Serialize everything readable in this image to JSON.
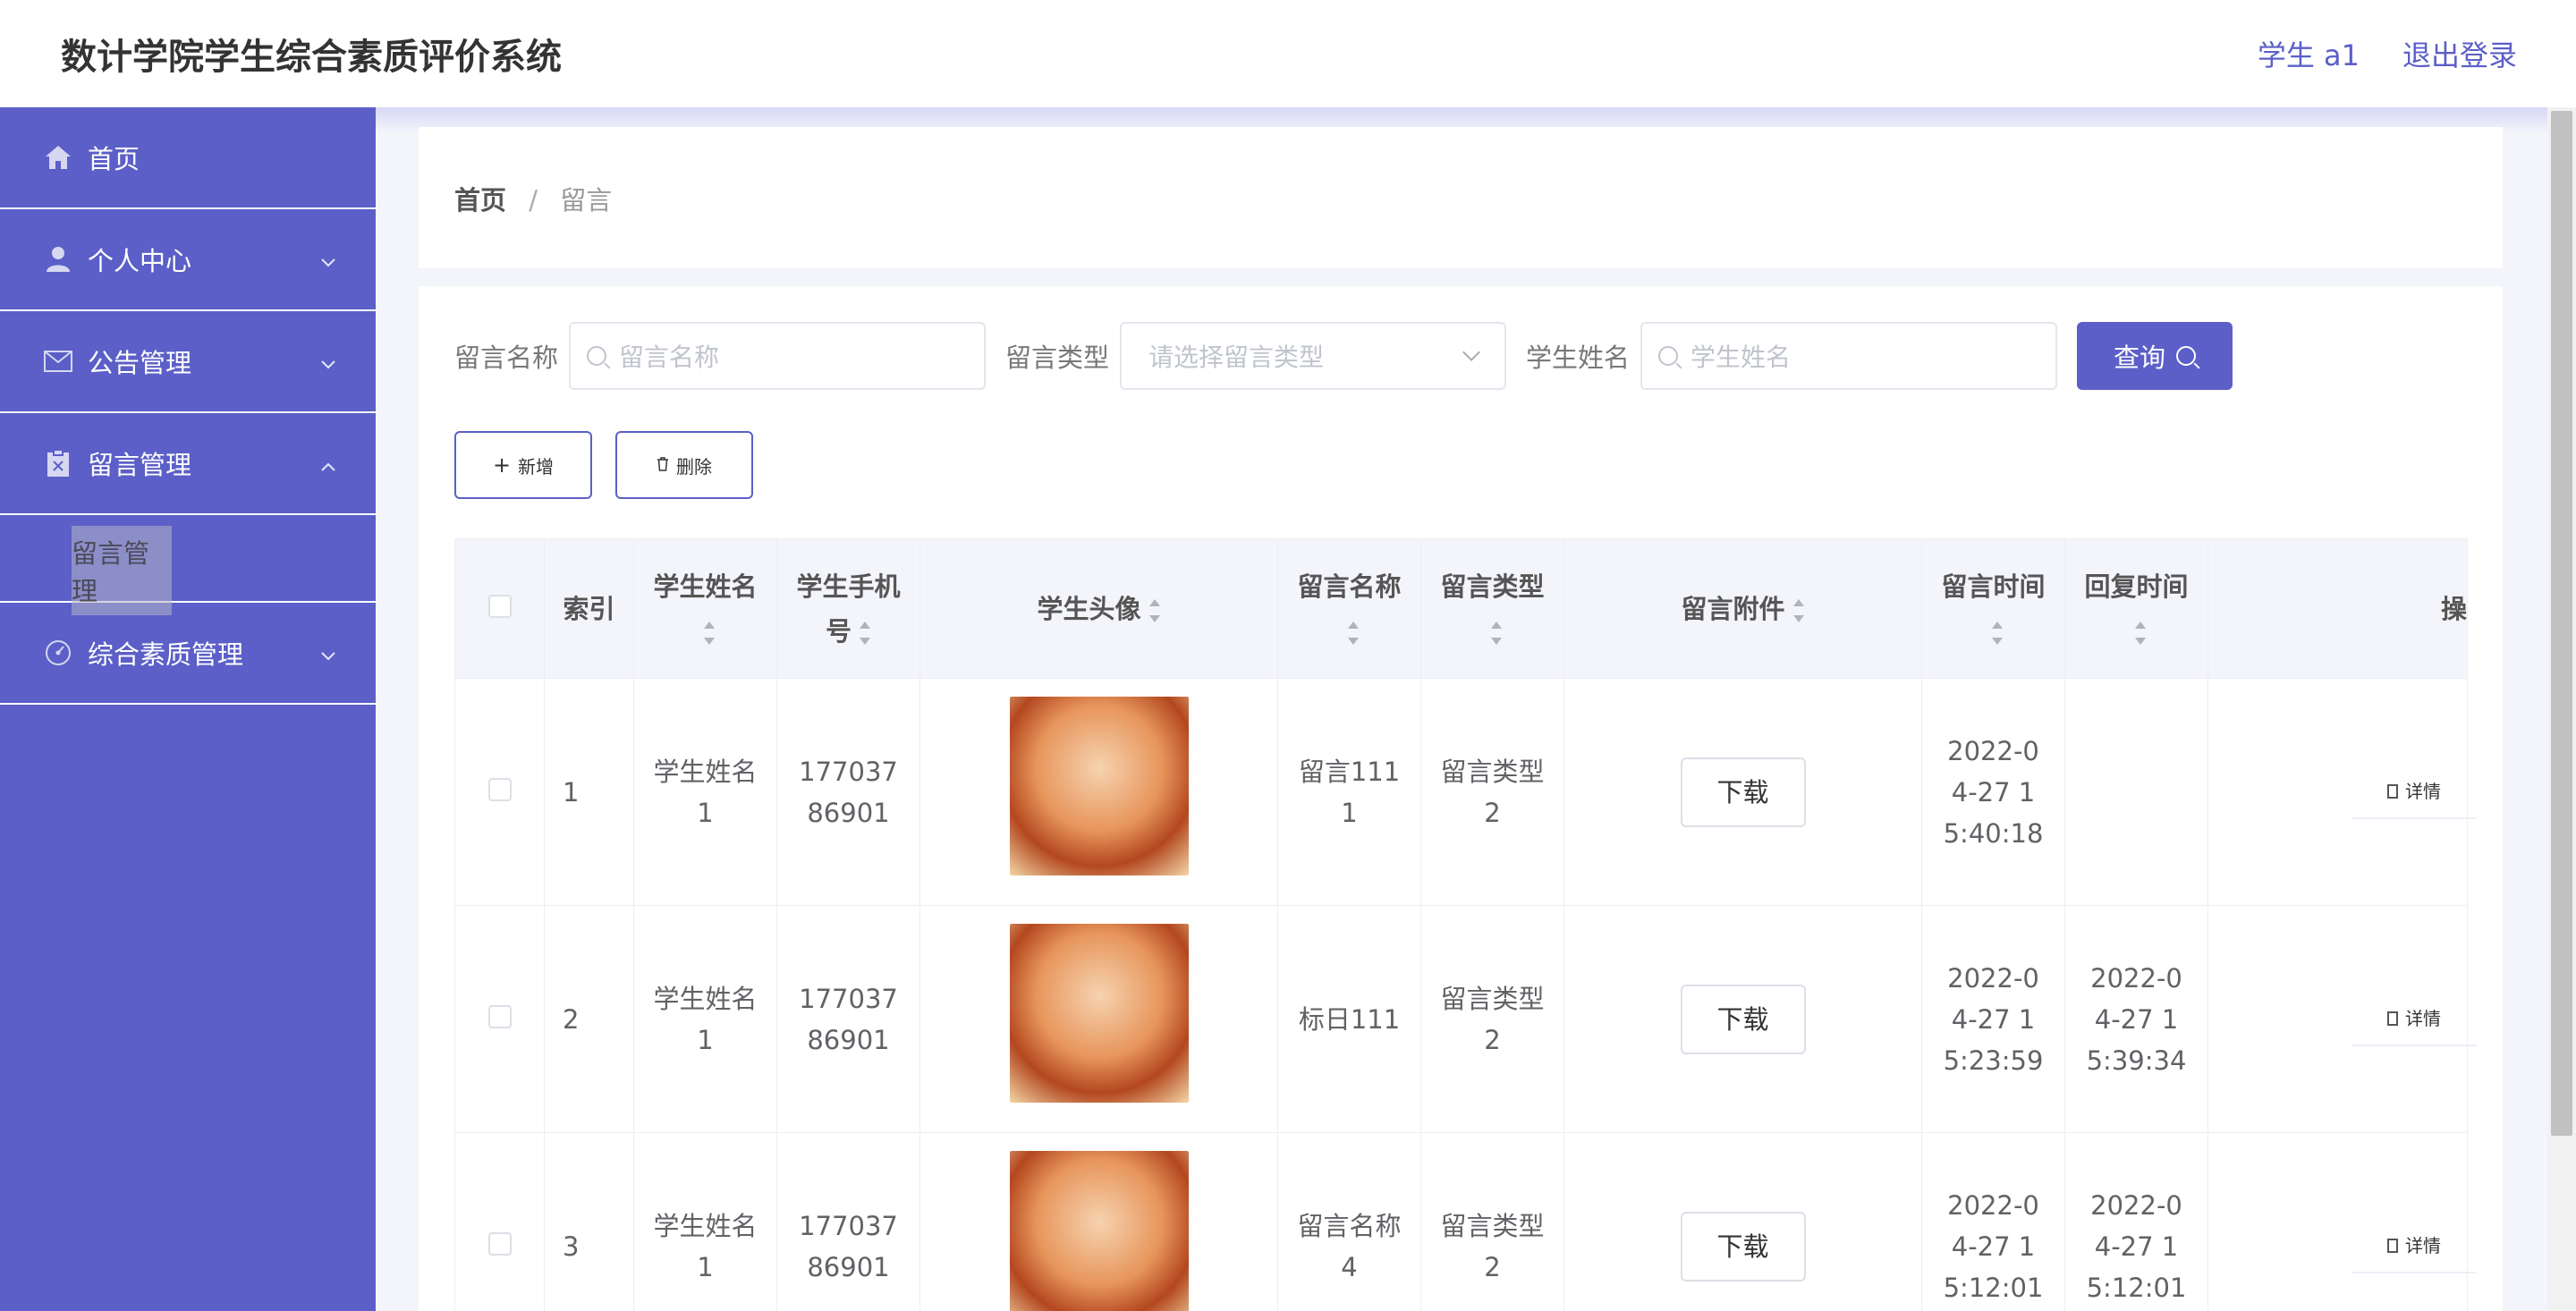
{
  "header": {
    "title": "数计学院学生综合素质评价系统",
    "user": "学生 a1",
    "logout": "退出登录"
  },
  "sidebar": {
    "items": [
      {
        "label": "首页",
        "icon": "home-icon"
      },
      {
        "label": "个人中心",
        "icon": "user-icon"
      },
      {
        "label": "公告管理",
        "icon": "mail-icon"
      },
      {
        "label": "留言管理",
        "icon": "clipboard-icon",
        "expanded": true,
        "sub": [
          "留言管理"
        ]
      },
      {
        "label": "综合素质管理",
        "icon": "gauge-icon"
      }
    ]
  },
  "breadcrumb": {
    "home": "首页",
    "sep": "/",
    "current": "留言"
  },
  "search": {
    "name_label": "留言名称",
    "name_placeholder": "留言名称",
    "type_label": "留言类型",
    "type_placeholder": "请选择留言类型",
    "student_label": "学生姓名",
    "student_placeholder": "学生姓名",
    "query_btn": "查询"
  },
  "actions": {
    "add": "新增",
    "delete": "删除"
  },
  "table": {
    "headers": {
      "index": "索引",
      "student_name": "学生姓名",
      "student_phone": "学生手机号",
      "student_avatar": "学生头像",
      "msg_name": "留言名称",
      "msg_type": "留言类型",
      "msg_attach": "留言附件",
      "msg_time": "留言时间",
      "reply_time": "回复时间",
      "op": "操"
    },
    "rows": [
      {
        "index": "1",
        "student_name": "学生姓名1",
        "phone": "17703786901",
        "msg_name": "留言1111",
        "msg_type": "留言类型2",
        "download": "下载",
        "msg_time": "2022-04-27 15:40:18",
        "reply_time": "",
        "detail": "详情"
      },
      {
        "index": "2",
        "student_name": "学生姓名1",
        "phone": "17703786901",
        "msg_name": "标日111",
        "msg_type": "留言类型2",
        "download": "下载",
        "msg_time": "2022-04-27 15:23:59",
        "reply_time": "2022-04-27 15:39:34",
        "detail": "详情"
      },
      {
        "index": "3",
        "student_name": "学生姓名1",
        "phone": "17703786901",
        "msg_name": "留言名称4",
        "msg_type": "留言类型2",
        "download": "下载",
        "msg_time": "2022-04-27 15:12:01",
        "reply_time": "2022-04-27 15:12:01",
        "detail": "详情"
      }
    ]
  },
  "colors": {
    "primary": "#5b5fc7",
    "bg": "#f4f5fb"
  }
}
